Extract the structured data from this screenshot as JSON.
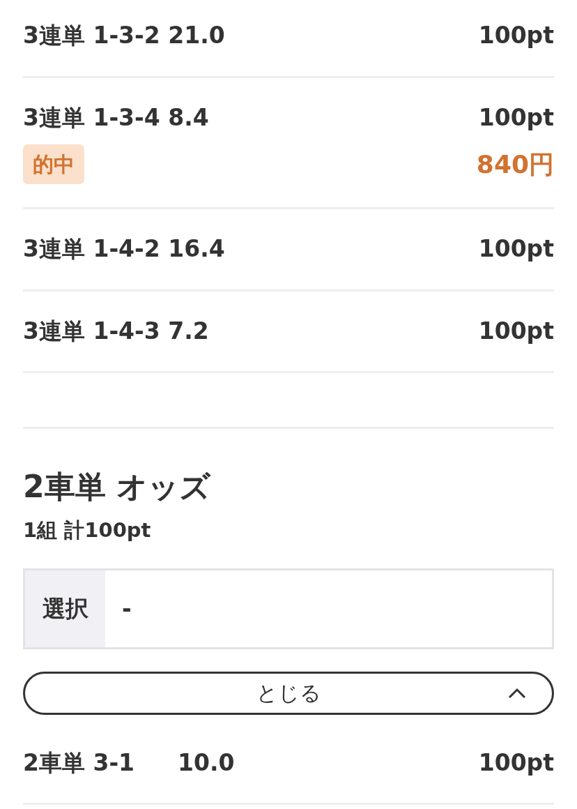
{
  "bets": [
    {
      "type": "3連単",
      "combo": "1-3-2",
      "odds": "21.0",
      "stake": "100pt",
      "hit": false
    },
    {
      "type": "3連単",
      "combo": "1-3-4",
      "odds": "8.4",
      "stake": "100pt",
      "hit": true,
      "hit_label": "的中",
      "payout": "840円"
    },
    {
      "type": "3連単",
      "combo": "1-4-2",
      "odds": "16.4",
      "stake": "100pt",
      "hit": false
    },
    {
      "type": "3連単",
      "combo": "1-4-3",
      "odds": "7.2",
      "stake": "100pt",
      "hit": false
    }
  ],
  "section": {
    "title": "2車単 オッズ",
    "summary": "1組 計100pt",
    "selection": {
      "label": "選択",
      "value": "-"
    },
    "toggle": {
      "label": "とじる",
      "expanded": true
    },
    "bets": [
      {
        "type": "2車単",
        "combo": "3-1",
        "odds": "10.0",
        "stake": "100pt",
        "hit": false
      }
    ]
  }
}
